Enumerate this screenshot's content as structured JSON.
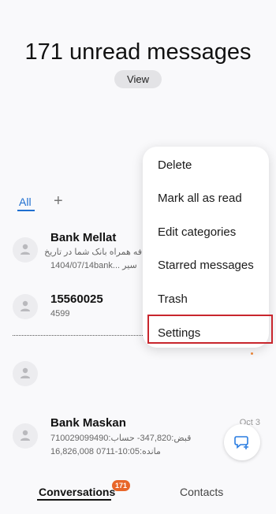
{
  "header": {
    "unread_title": "171 unread messages",
    "view_label": "View"
  },
  "categories": {
    "all_label": "All",
    "add_symbol": "+"
  },
  "conversations": [
    {
      "name": "Bank Mellat",
      "line1": "فه همراه بانک شما در تاریخ",
      "line2": "1404/07/14bank... سیر",
      "date": ""
    },
    {
      "name": "15560025",
      "line1": "4599",
      "line2": "",
      "date": ""
    },
    {
      "name": "",
      "line1": "",
      "line2": "",
      "date": ""
    },
    {
      "name": "Bank Maskan",
      "line1": "قبض:347,820- حساب:710029099490",
      "line2": "مانده:10:05-0711 16,826,008",
      "date": "Oct 3"
    }
  ],
  "menu": {
    "items": [
      "Delete",
      "Mark all as read",
      "Edit categories",
      "Starred messages",
      "Trash",
      "Settings"
    ],
    "highlighted": "Settings",
    "highlight_color": "#c8262d"
  },
  "bottom_nav": {
    "conversations_label": "Conversations",
    "conversations_badge": "171",
    "contacts_label": "Contacts"
  },
  "colors": {
    "accent": "#1f6fd0",
    "badge": "#e8662a",
    "fab_icon": "#2a7de1"
  },
  "icons": {
    "avatar": "person-icon",
    "fab": "compose-message-icon"
  }
}
